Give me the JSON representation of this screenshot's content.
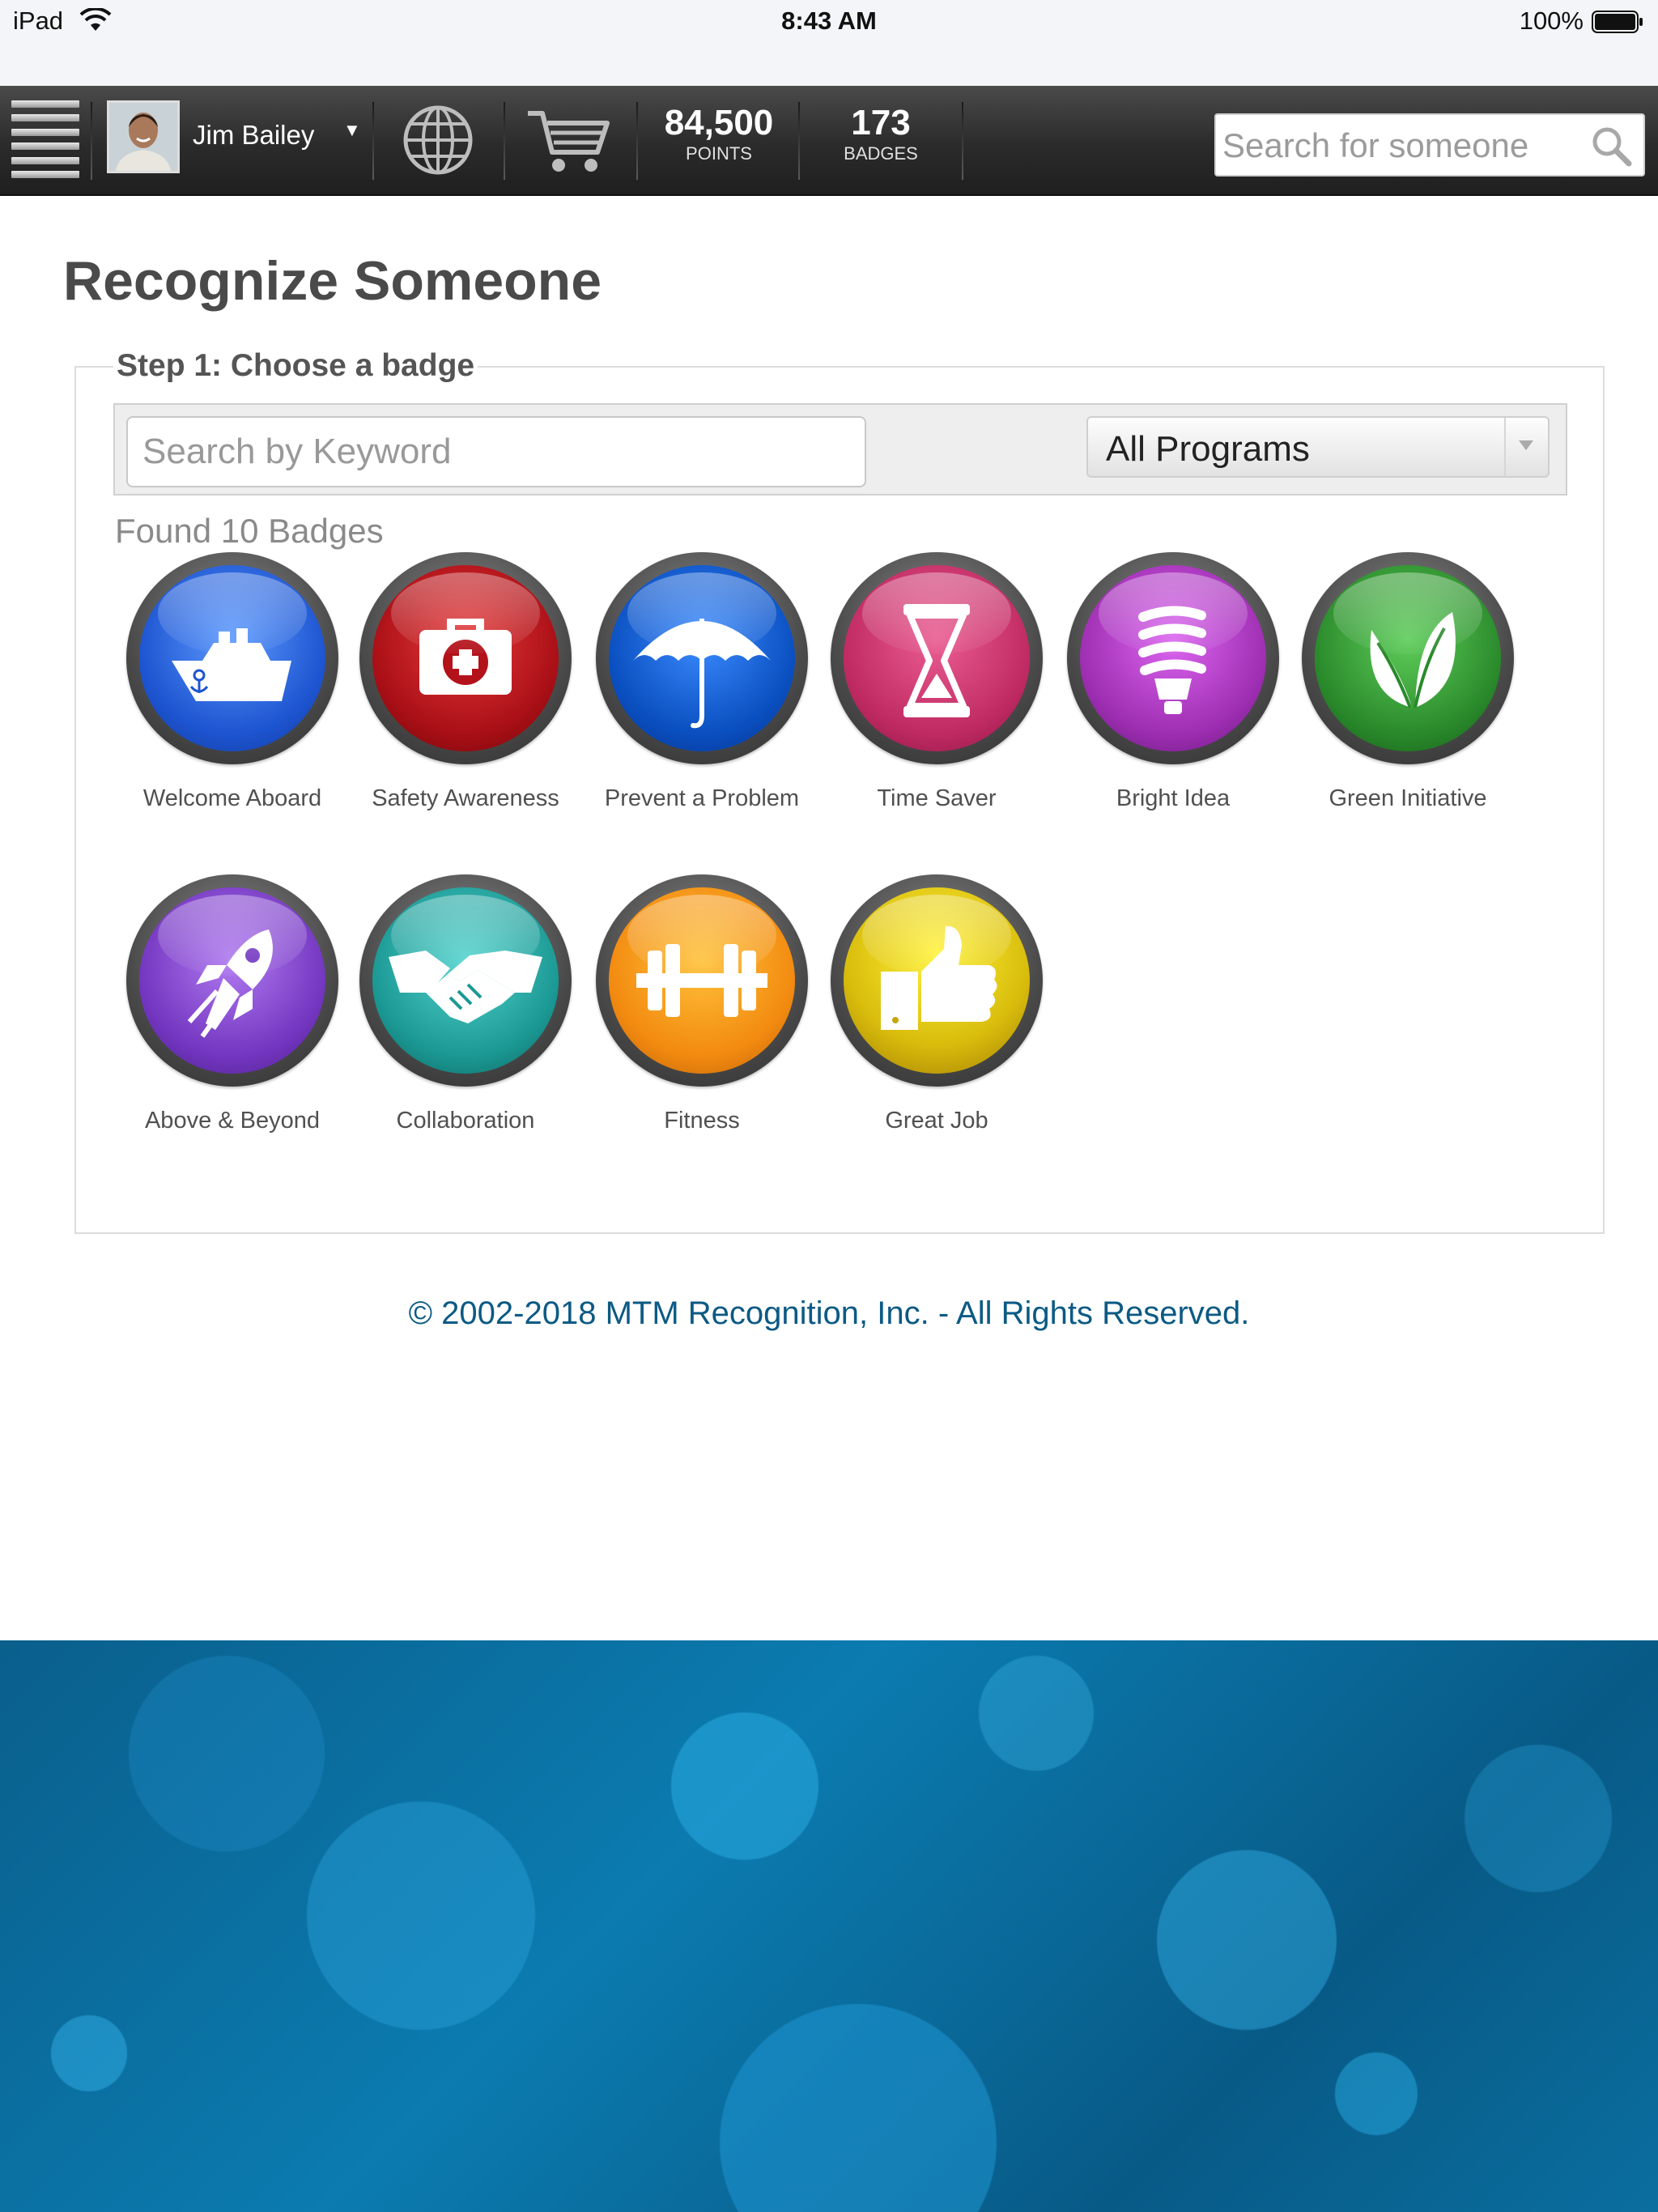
{
  "status_bar": {
    "device": "iPad",
    "time": "8:43 AM",
    "battery": "100%"
  },
  "header": {
    "user_name": "Jim Bailey",
    "points": {
      "value": "84,500",
      "label": "POINTS"
    },
    "badges": {
      "value": "173",
      "label": "BADGES"
    },
    "search_placeholder": "Search for someone"
  },
  "page": {
    "title": "Recognize Someone",
    "step_legend": "Step 1: Choose a badge",
    "keyword_placeholder": "Search by Keyword",
    "program_select": "All Programs",
    "found_text": "Found 10 Badges"
  },
  "badges": [
    {
      "name": "Welcome Aboard",
      "icon": "ship-icon",
      "color": "#1f5fd6"
    },
    {
      "name": "Safety Awareness",
      "icon": "first-aid-kit-icon",
      "color": "#b3121a"
    },
    {
      "name": "Prevent a Problem",
      "icon": "umbrella-icon",
      "color": "#0a57c8"
    },
    {
      "name": "Time Saver",
      "icon": "hourglass-icon",
      "color": "#c42f68"
    },
    {
      "name": "Bright Idea",
      "icon": "light-bulb-icon",
      "color": "#a12fb5"
    },
    {
      "name": "Green Initiative",
      "icon": "leaf-icon",
      "color": "#2c8a2c"
    },
    {
      "name": "Above & Beyond",
      "icon": "rocket-icon",
      "color": "#7a3cc4"
    },
    {
      "name": "Collaboration",
      "icon": "handshake-icon",
      "color": "#1c9c98"
    },
    {
      "name": "Fitness",
      "icon": "dumbbell-icon",
      "color": "#f08a12"
    },
    {
      "name": "Great Job",
      "icon": "thumbs-up-icon",
      "color": "#d4b80a"
    }
  ],
  "footer": {
    "copyright": "© 2002-2018 MTM Recognition, Inc. - All Rights Reserved."
  }
}
